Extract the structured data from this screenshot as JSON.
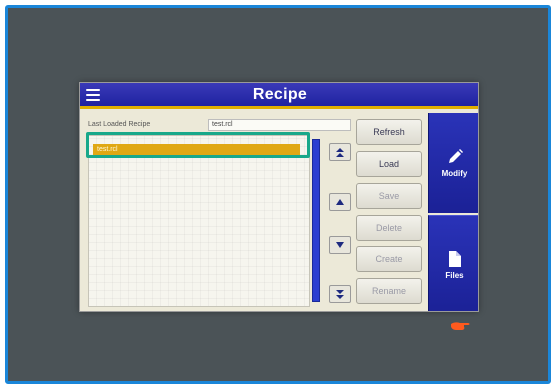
{
  "window": {
    "title": "Recipe"
  },
  "recipe": {
    "last_loaded_label": "Last Loaded Recipe",
    "last_loaded_value": "test.rcl",
    "items": [
      {
        "label": "test.rcl",
        "selected": true
      }
    ]
  },
  "buttons": {
    "refresh": "Refresh",
    "load": "Load",
    "save": "Save",
    "delete": "Delete",
    "create": "Create",
    "rename": "Rename"
  },
  "side_panel": {
    "modify": "Modify",
    "files": "Files"
  },
  "icons": {
    "menu": "menu-icon",
    "scroll_top": "double-chevron-up-icon",
    "scroll_up": "triangle-up-icon",
    "scroll_down": "triangle-down-icon",
    "scroll_bottom": "double-chevron-down-icon",
    "modify": "pencil-icon",
    "files": "file-icon",
    "touch": "pointing-hand-icon"
  },
  "colors": {
    "frame_border": "#1a86d9",
    "background": "#4b5357",
    "titlebar": "#1f23a0",
    "accent_bar": "#e0b000",
    "selected_item": "#e0a814",
    "highlight_box": "#18a88a",
    "side_panel": "#2a33b8",
    "hand": "#ff5a1e"
  }
}
